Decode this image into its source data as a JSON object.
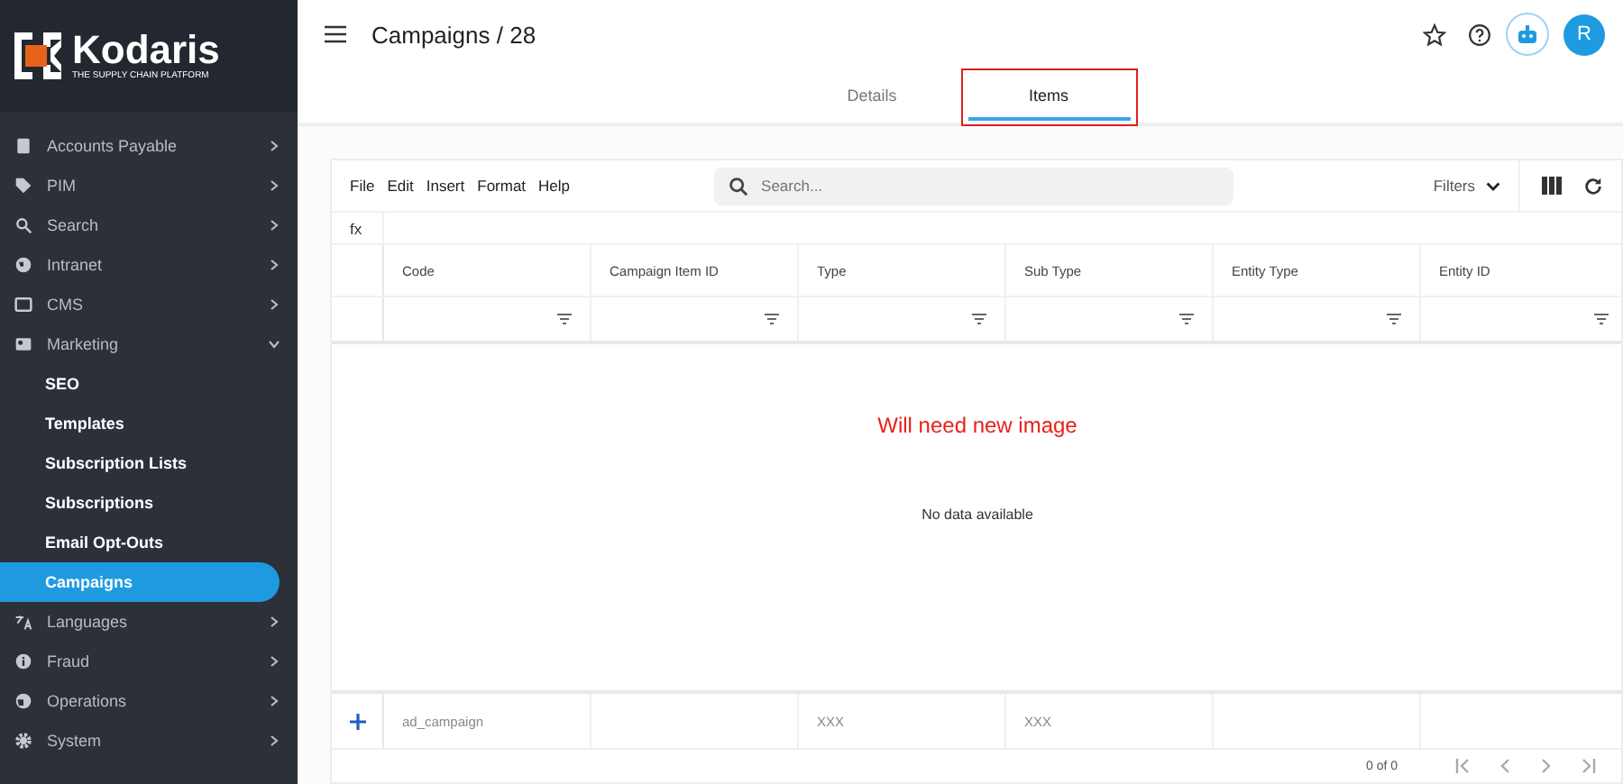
{
  "sidebar": {
    "logo": {
      "name": "Kodaris",
      "tagline": "THE SUPPLY CHAIN PLATFORM"
    },
    "items": [
      {
        "label": "Accounts Payable",
        "selected": false,
        "expanded": false
      },
      {
        "label": "PIM",
        "selected": false,
        "expanded": false
      },
      {
        "label": "Search",
        "selected": false,
        "expanded": false
      },
      {
        "label": "Intranet",
        "selected": false,
        "expanded": false
      },
      {
        "label": "CMS",
        "selected": false,
        "expanded": false
      },
      {
        "label": "Marketing",
        "selected": false,
        "expanded": true,
        "children": [
          {
            "label": "SEO",
            "selected": false
          },
          {
            "label": "Templates",
            "selected": false
          },
          {
            "label": "Subscription Lists",
            "selected": false
          },
          {
            "label": "Subscriptions",
            "selected": false
          },
          {
            "label": "Email Opt-Outs",
            "selected": false
          },
          {
            "label": "Campaigns",
            "selected": true
          }
        ]
      },
      {
        "label": "Languages",
        "selected": false,
        "expanded": false
      },
      {
        "label": "Fraud",
        "selected": false,
        "expanded": false
      },
      {
        "label": "Operations",
        "selected": false,
        "expanded": false
      },
      {
        "label": "System",
        "selected": false,
        "expanded": false
      }
    ]
  },
  "header": {
    "title": "Campaigns / 28",
    "avatar": "R"
  },
  "tabs": [
    {
      "label": "Details",
      "selected": false,
      "highlighted": false
    },
    {
      "label": "Items",
      "selected": true,
      "highlighted": true
    }
  ],
  "toolbar": {
    "menu": [
      "File",
      "Edit",
      "Insert",
      "Format",
      "Help"
    ],
    "search": {
      "placeholder": "Search..."
    },
    "filters": "Filters"
  },
  "formula_bar": {
    "label": "fx"
  },
  "table": {
    "columns": [
      "Code",
      "Campaign Item ID",
      "Type",
      "Sub Type",
      "Entity Type",
      "Entity ID"
    ],
    "annotation": "Will need new image",
    "empty_message": "No data available",
    "new_row": {
      "code": "ad_campaign",
      "type": "XXX",
      "sub_type": "XXX"
    }
  },
  "pagination": {
    "summary": "0 of 0"
  }
}
